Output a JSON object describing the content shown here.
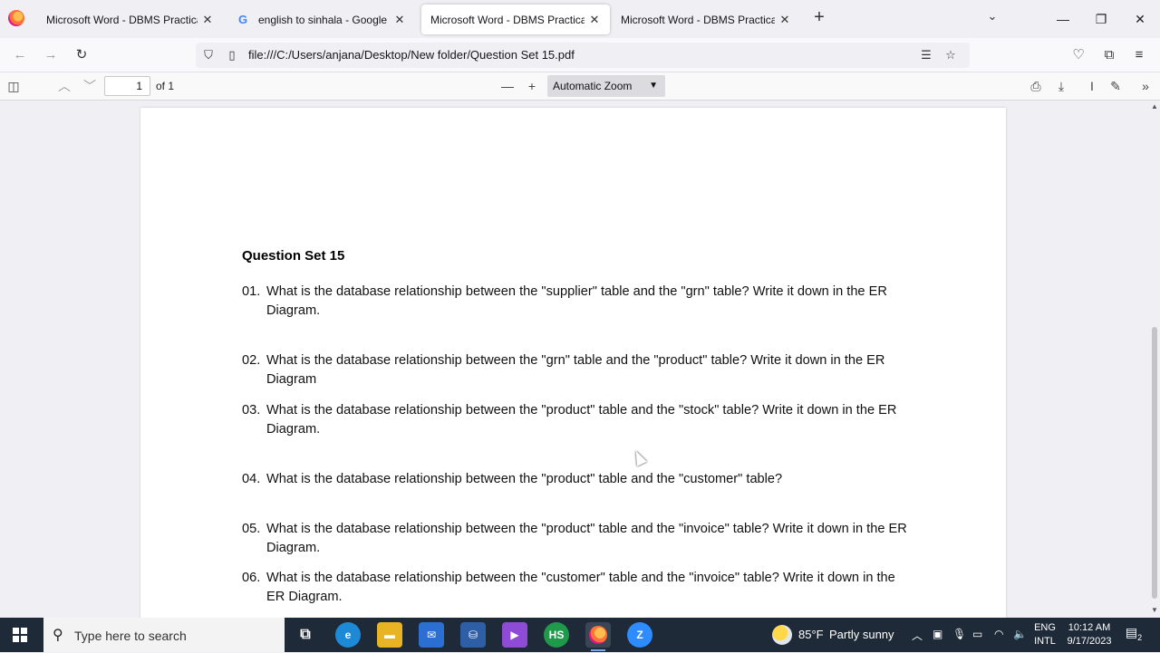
{
  "browser": {
    "tabs": [
      {
        "label": "Microsoft Word - DBMS Practical Q",
        "active": false
      },
      {
        "label": "english to sinhala - Google Sear",
        "active": false
      },
      {
        "label": "Microsoft Word - DBMS Practical Q",
        "active": true
      },
      {
        "label": "Microsoft Word - DBMS Practical Q",
        "active": false
      }
    ],
    "new_tab_icon": "+",
    "url": "file:///C:/Users/anjana/Desktop/New folder/Question Set 15.pdf"
  },
  "pdf_toolbar": {
    "page_number": "1",
    "page_count": "of 1",
    "zoom_label": "Automatic Zoom"
  },
  "document": {
    "title": "Question Set 15",
    "questions": [
      {
        "num": "01.",
        "text": "What is the database relationship between the \"supplier\" table and the \"grn\" table? Write it down in the ER Diagram."
      },
      {
        "num": "02.",
        "text": "What is the database relationship between the \"grn\" table and the \"product\" table? Write it down in the ER Diagram"
      },
      {
        "num": "03.",
        "text": "What is the database relationship between the \"product\" table and the \"stock\" table? Write it down in the ER Diagram."
      },
      {
        "num": "04.",
        "text": "What is the database relationship between the \"product\" table and the \"customer\" table?"
      },
      {
        "num": "05.",
        "text": "What is the database relationship between the \"product\" table and the \"invoice\" table? Write it down in the ER Diagram."
      },
      {
        "num": "06.",
        "text": "What is the database relationship between the \"customer\" table and the \"invoice\" table? Write it down in the ER Diagram."
      }
    ]
  },
  "taskbar": {
    "search_placeholder": "Type here to search",
    "weather": {
      "temp": "85°F",
      "condition": "Partly sunny"
    },
    "lang": {
      "line1": "ENG",
      "line2": "INTL"
    },
    "clock": {
      "time": "10:12 AM",
      "date": "9/17/2023"
    },
    "notifications_count": "2",
    "app_labels": {
      "hs": "HS",
      "zoom": "Z"
    }
  },
  "colors": {
    "accent": "#0060df",
    "taskbar": "#1f2a38"
  }
}
